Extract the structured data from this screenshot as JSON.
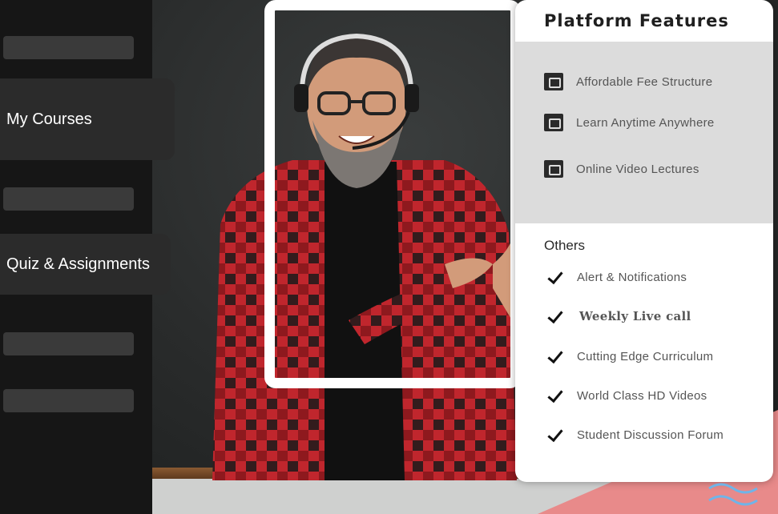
{
  "sidebar": {
    "items": [
      {
        "label": "My Courses"
      },
      {
        "label": "Quiz & Assignments"
      }
    ]
  },
  "panel": {
    "title": "Platform Features",
    "features": [
      {
        "label": "Affordable Fee Structure",
        "icon": "fee-icon"
      },
      {
        "label": "Learn Anytime Anywhere",
        "icon": "calendar-icon"
      },
      {
        "label": "Online Video Lectures",
        "icon": "video-icon"
      }
    ],
    "others_title": "Others",
    "others": [
      {
        "label": "Alert & Notifications"
      },
      {
        "label": "Weekly Live call"
      },
      {
        "label": "Cutting Edge Curriculum"
      },
      {
        "label": "World Class HD Videos"
      },
      {
        "label": "Student Discussion Forum"
      }
    ]
  },
  "colors": {
    "sidebar_bg": "#161616",
    "panel_bg": "#ffffff",
    "feature_box_bg": "#dcdcdc",
    "shirt_red": "#c0262d"
  }
}
